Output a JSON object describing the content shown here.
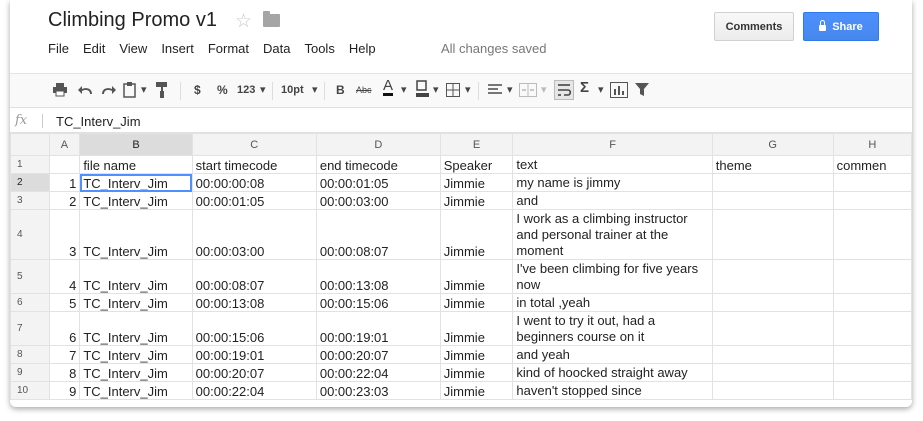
{
  "document": {
    "title": "Climbing Promo v1",
    "status": "All changes saved"
  },
  "menu": [
    "File",
    "Edit",
    "View",
    "Insert",
    "Format",
    "Data",
    "Tools",
    "Help"
  ],
  "buttons": {
    "comments": "Comments",
    "share": "Share"
  },
  "toolbar": {
    "currency": "$",
    "percent": "%",
    "number_format": "123",
    "font_size": "10pt",
    "bold": "B",
    "strikethrough": "Abc",
    "text_color": "A",
    "sum": "Σ"
  },
  "formula_bar": {
    "fx_label": "fx",
    "value": "TC_Interv_Jim"
  },
  "columns": [
    "A",
    "B",
    "C",
    "D",
    "E",
    "F",
    "G",
    "H"
  ],
  "rows": [
    {
      "n": "1",
      "a": "",
      "b": "file name",
      "c": "start timecode",
      "d": "end timecode",
      "e": "Speaker",
      "f": "text",
      "g": "theme",
      "h": "commen"
    },
    {
      "n": "2",
      "a": "1",
      "b": "TC_Interv_Jim",
      "c": "00:00:00:08",
      "d": "00:00:01:05",
      "e": "Jimmie",
      "f": "my name is jimmy",
      "g": "",
      "h": ""
    },
    {
      "n": "3",
      "a": "2",
      "b": "TC_Interv_Jim",
      "c": "00:00:01:05",
      "d": "00:00:03:00",
      "e": "Jimmie",
      "f": "and",
      "g": "",
      "h": ""
    },
    {
      "n": "4",
      "a": "3",
      "b": "TC_Interv_Jim",
      "c": "00:00:03:00",
      "d": "00:00:08:07",
      "e": "Jimmie",
      "f": "I work as a climbing instructor and personal trainer at the moment",
      "g": "",
      "h": ""
    },
    {
      "n": "5",
      "a": "4",
      "b": "TC_Interv_Jim",
      "c": "00:00:08:07",
      "d": "00:00:13:08",
      "e": "Jimmie",
      "f": "I've been climbing for five years now",
      "g": "",
      "h": ""
    },
    {
      "n": "6",
      "a": "5",
      "b": "TC_Interv_Jim",
      "c": "00:00:13:08",
      "d": "00:00:15:06",
      "e": "Jimmie",
      "f": "in total ,yeah",
      "g": "",
      "h": ""
    },
    {
      "n": "7",
      "a": "6",
      "b": "TC_Interv_Jim",
      "c": "00:00:15:06",
      "d": "00:00:19:01",
      "e": "Jimmie",
      "f": "I went to try it out, had a beginners course on it",
      "g": "",
      "h": ""
    },
    {
      "n": "8",
      "a": "7",
      "b": "TC_Interv_Jim",
      "c": "00:00:19:01",
      "d": "00:00:20:07",
      "e": "Jimmie",
      "f": "and yeah",
      "g": "",
      "h": ""
    },
    {
      "n": "9",
      "a": "8",
      "b": "TC_Interv_Jim",
      "c": "00:00:20:07",
      "d": "00:00:22:04",
      "e": "Jimmie",
      "f": "kind of hoocked straight away",
      "g": "",
      "h": ""
    },
    {
      "n": "10",
      "a": "9",
      "b": "TC_Interv_Jim",
      "c": "00:00:22:04",
      "d": "00:00:23:03",
      "e": "Jimmie",
      "f": "haven't stopped since",
      "g": "",
      "h": ""
    }
  ]
}
